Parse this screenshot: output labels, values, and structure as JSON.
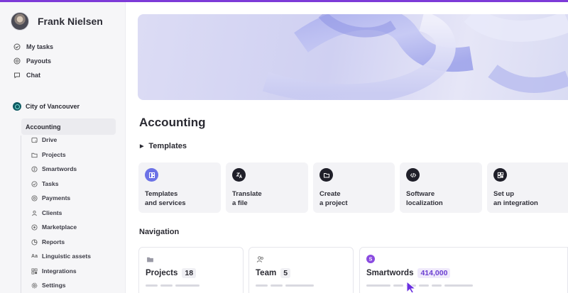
{
  "colors": {
    "accent": "#7d3ad8",
    "hero_start": "#dcdcf4",
    "hero_end": "#d9dbf3",
    "count_purple": "#6b3fd1"
  },
  "profile": {
    "name": "Frank Nielsen",
    "avatar_icon": "user-avatar"
  },
  "personal_nav": [
    {
      "label": "My tasks",
      "icon": "check-circle-icon"
    },
    {
      "label": "Payouts",
      "icon": "coin-icon"
    },
    {
      "label": "Chat",
      "icon": "chat-bubble-icon"
    }
  ],
  "organization": {
    "name": "City of Vancouver",
    "icon": "org-logo-icon"
  },
  "active_section": "Accounting",
  "sub_nav": [
    {
      "label": "Drive",
      "icon": "drive-icon"
    },
    {
      "label": "Projects",
      "icon": "folder-icon"
    },
    {
      "label": "Smartwords",
      "icon": "smartwords-icon"
    },
    {
      "label": "Tasks",
      "icon": "check-circle-icon"
    },
    {
      "label": "Payments",
      "icon": "coin-icon"
    },
    {
      "label": "Clients",
      "icon": "person-icon"
    },
    {
      "label": "Marketplace",
      "icon": "marketplace-icon"
    },
    {
      "label": "Reports",
      "icon": "chart-pie-icon"
    },
    {
      "label": "Linguistic assets",
      "icon": "text-aa-icon"
    },
    {
      "label": "Integrations",
      "icon": "integrations-icon"
    },
    {
      "label": "Settings",
      "icon": "gear-icon"
    }
  ],
  "main": {
    "title": "Accounting",
    "templates_toggle": "Templates",
    "templates": [
      {
        "line1": "Templates",
        "line2": "and services",
        "icon": "templates-icon"
      },
      {
        "line1": "Translate",
        "line2": "a file",
        "icon": "translate-icon"
      },
      {
        "line1": "Create",
        "line2": "a project",
        "icon": "folder-icon"
      },
      {
        "line1": "Software",
        "line2": "localization",
        "icon": "code-icon"
      },
      {
        "line1": "Set up",
        "line2": "an integration",
        "icon": "integration-icon"
      }
    ],
    "navigation_heading": "Navigation",
    "nav_cards": [
      {
        "title": "Projects",
        "count": "18",
        "icon": "folder-icon"
      },
      {
        "title": "Team",
        "count": "5",
        "icon": "team-icon"
      },
      {
        "title": "Smartwords",
        "count": "414,000",
        "icon": "smartwords-badge-icon"
      }
    ]
  }
}
